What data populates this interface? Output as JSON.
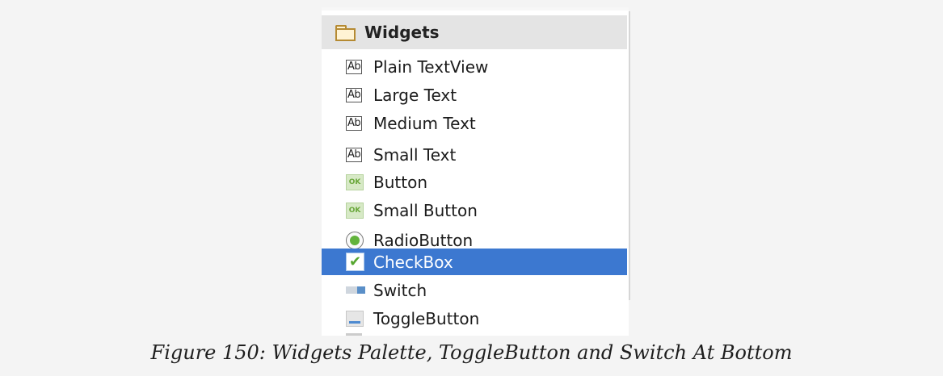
{
  "palette": {
    "header": {
      "label": "Widgets",
      "icon": "folder-icon"
    },
    "items": [
      {
        "label": "Plain TextView",
        "icon": "textview-icon",
        "icon_text": "Ab"
      },
      {
        "label": "Large Text",
        "icon": "textview-icon",
        "icon_text": "Ab"
      },
      {
        "label": "Medium Text",
        "icon": "textview-icon",
        "icon_text": "Ab"
      },
      {
        "label": "Small Text",
        "icon": "textview-icon",
        "icon_text": "Ab"
      },
      {
        "label": "Button",
        "icon": "button-icon",
        "icon_text": "OK"
      },
      {
        "label": "Small Button",
        "icon": "button-icon",
        "icon_text": "OK"
      },
      {
        "label": "RadioButton",
        "icon": "radio-icon"
      },
      {
        "label": "CheckBox",
        "icon": "checkbox-icon",
        "selected": true
      },
      {
        "label": "Switch",
        "icon": "switch-icon"
      },
      {
        "label": "ToggleButton",
        "icon": "toggle-icon"
      }
    ],
    "selection_color": "#3c78d0"
  },
  "caption": "Figure 150: Widgets Palette, ToggleButton and Switch At Bottom"
}
